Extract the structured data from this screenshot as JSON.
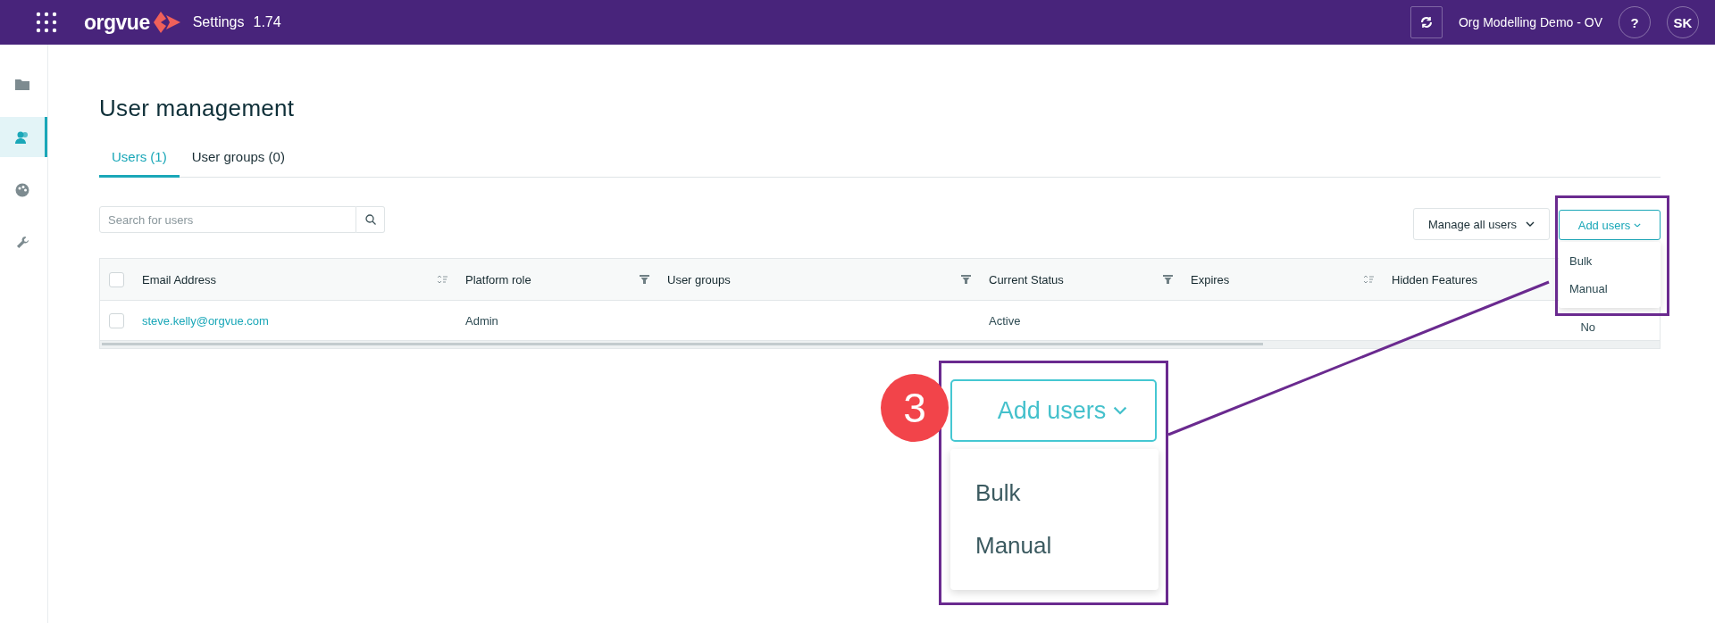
{
  "top_bar": {
    "logo": "orgvue",
    "app_name": "Settings",
    "version": "1.74",
    "workspace": "Org Modelling Demo - OV",
    "help": "?",
    "avatar": "SK"
  },
  "sidebar": {
    "items": [
      {
        "kind": "folder",
        "selected": false
      },
      {
        "kind": "users",
        "selected": true
      },
      {
        "kind": "palette",
        "selected": false
      },
      {
        "kind": "wrench",
        "selected": false
      }
    ]
  },
  "page": {
    "title": "User management"
  },
  "tabs": [
    {
      "label": "Users (1)",
      "selected": true
    },
    {
      "label": "User groups (0)",
      "selected": false
    }
  ],
  "search": {
    "placeholder": "Search for users"
  },
  "actions": {
    "manage": "Manage all users",
    "add": "Add users"
  },
  "add_menu": [
    "Bulk",
    "Manual"
  ],
  "table": {
    "header_checked": false,
    "columns": [
      {
        "label": "Email Address",
        "kind": "sortable"
      },
      {
        "label": "Platform role",
        "kind": "filterable"
      },
      {
        "label": "User groups",
        "kind": "filterable"
      },
      {
        "label": "Current Status",
        "kind": "filterable"
      },
      {
        "label": "Expires",
        "kind": "sortable"
      },
      {
        "label": "Hidden Features",
        "kind": "plain"
      }
    ],
    "rows": [
      {
        "checked": false,
        "email": "steve.kelly@orgvue.com",
        "platform_role": "Admin",
        "current_status": "Active",
        "hidden_features": "No"
      }
    ]
  },
  "callout": {
    "step": "3",
    "button": "Add users",
    "menu": [
      "Bulk",
      "Manual"
    ]
  }
}
